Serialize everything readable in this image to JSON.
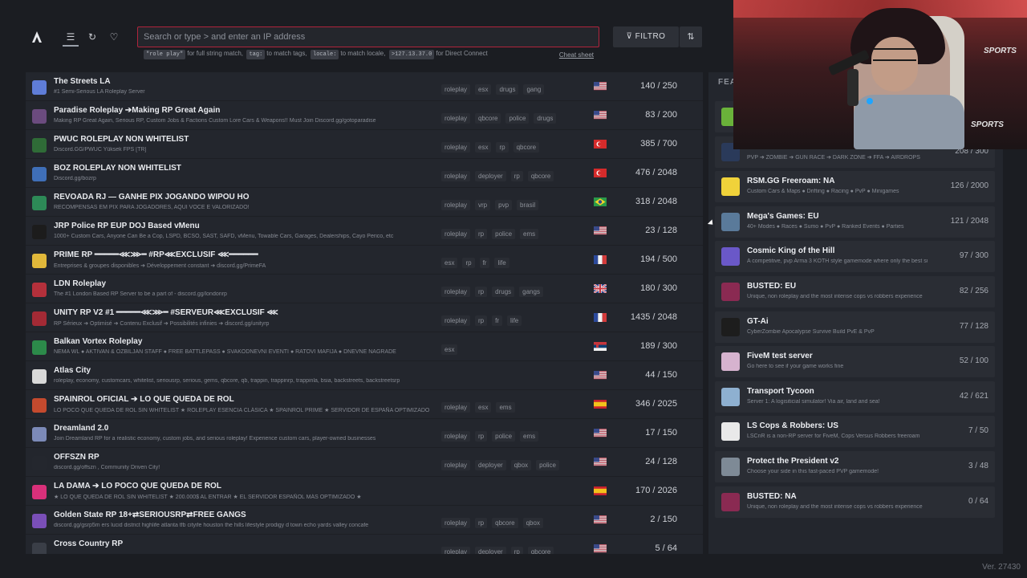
{
  "app": {
    "version": "Ver. 27430"
  },
  "toolbar": {
    "search_placeholder": "Search or type > and enter an IP address",
    "filter_label": "⊽ FILTRO",
    "sort_glyph": "⇅",
    "hints": [
      {
        "chip": "\"role play\"",
        "text": "for full string match,"
      },
      {
        "chip": "tag:",
        "text": "to match tags,"
      },
      {
        "chip": "locale:",
        "text": "to match locale,"
      },
      {
        "chip": ">127.13.37.0",
        "text": "for Direct Connect"
      }
    ],
    "cheat_sheet": "Cheat sheet"
  },
  "servers": [
    {
      "name": "The Streets LA",
      "desc": "#1 Semi-Serious LA Roleplay Server",
      "tags": [
        "roleplay",
        "esx",
        "drugs",
        "gang"
      ],
      "flag": "us",
      "players": "140 / 250",
      "icon_color": "#5f7dd8"
    },
    {
      "name": "Paradise Roleplay ➔Making RP Great Again",
      "desc": "Making RP Great Again, Serious RP, Custom Jobs & Factions Custom Lore Cars & Weapons!! Must Join Discord.gg/gotoparadise",
      "tags": [
        "roleplay",
        "qbcore",
        "police",
        "drugs"
      ],
      "flag": "us",
      "players": "83 / 200",
      "icon_color": "#6b4b7e"
    },
    {
      "name": "PWUC ROLEPLAY NON WHITELIST",
      "desc": "Discord.GG/PWUC Yüksek FPS [TR]",
      "tags": [
        "roleplay",
        "esx",
        "rp",
        "qbcore"
      ],
      "flag": "tr",
      "players": "385 / 700",
      "icon_color": "#2f6b37"
    },
    {
      "name": "BOZ ROLEPLAY NON WHITELIST",
      "desc": "Discord.gg/bozrp",
      "tags": [
        "roleplay",
        "deployer",
        "rp",
        "qbcore"
      ],
      "flag": "tr",
      "players": "476 / 2048",
      "icon_color": "#3f6fb8"
    },
    {
      "name": "REVOADA RJ — GANHE PIX JOGANDO WIPOU HO",
      "desc": "RECOMPENSAS EM PIX PARA JOGADORES, AQUI VOCÊ É VALORIZADO!",
      "tags": [
        "roleplay",
        "vrp",
        "pvp",
        "brasil"
      ],
      "flag": "br",
      "players": "318 / 2048",
      "icon_color": "#2d8a57"
    },
    {
      "name": "JRP Police RP EUP DOJ Based vMenu",
      "desc": "1000+ Custom Cars, Anyone Can Be a Cop, LSPD, BCSO, SAST, SAFD, vMenu, Towable Cars, Garages, Dealerships, Cayo Perico, etc",
      "tags": [
        "roleplay",
        "rp",
        "police",
        "ems"
      ],
      "flag": "us",
      "players": "23 / 128",
      "icon_color": "#1c1c1c"
    },
    {
      "name": "PRIME RP ━━━━━⋘⋙━ #RP⋘EXCLUSIF ⋘━━━━━━",
      "desc": "Entreprises & groupes disponibles ➔ Développement constant ➔ discord.gg/PrimeFA",
      "tags": [
        "esx",
        "rp",
        "fr",
        "life"
      ],
      "flag": "fr",
      "players": "194 / 500",
      "icon_color": "#e1b83a"
    },
    {
      "name": "LDN Roleplay",
      "desc": "The #1 London Based RP Server to be a part of - discord.gg/londonrp",
      "tags": [
        "roleplay",
        "rp",
        "drugs",
        "gangs"
      ],
      "flag": "uk",
      "players": "180 / 300",
      "icon_color": "#b4303b"
    },
    {
      "name": "UNITY RP V2 #1 ━━━━━⋘⋙━ #SERVEUR⋘EXCLUSIF ⋘",
      "desc": "RP Sérieux ➔ Optimisé ➔ Contenu Exclusif ➔ Possibilités infinies ➔ discord.gg/unityrp",
      "tags": [
        "roleplay",
        "rp",
        "fr",
        "life"
      ],
      "flag": "fr",
      "players": "1435 / 2048",
      "icon_color": "#a32a35"
    },
    {
      "name": "Balkan Vortex Roleplay",
      "desc": "NEMA WL ● AKTIVAN & OZBILJAN STAFF ● FREE BATTLEPASS ● SVAKODNEVNI EVENTI ● RATOVI MAFIJA ● DNEVNE NAGRADE",
      "tags": [
        "esx"
      ],
      "flag": "rs",
      "players": "189 / 300",
      "icon_color": "#2c8a4a"
    },
    {
      "name": "Atlas City",
      "desc": "roleplay, economy, customcars, whitelist, seriousrp, serious, gems, qbcore, qb, trappin, trappinrp, trappinla, bsia, backstreets, backstreetsrp",
      "tags": [],
      "flag": "us",
      "players": "44 / 150",
      "icon_color": "#d9d9d9"
    },
    {
      "name": "SPAINROL OFICIAL ➔ LO QUE QUEDA DE ROL",
      "desc": "LO POCO QUE QUEDA DE ROL SIN WHITELIST ★ ROLEPLAY ESENCIA CLÁSICA ★ SPAINROL PRIME ★ SERVIDOR DE ESPAÑA OPTIMIZADO",
      "tags": [
        "roleplay",
        "esx",
        "ems"
      ],
      "flag": "es",
      "players": "346 / 2025",
      "icon_color": "#c44a2e"
    },
    {
      "name": "Dreamland 2.0",
      "desc": "Join Dreamland RP for a realistic economy, custom jobs, and serious roleplay! Experience custom cars, player-owned businesses",
      "tags": [
        "roleplay",
        "rp",
        "police",
        "ems"
      ],
      "flag": "us",
      "players": "17 / 150",
      "icon_color": "#7c8ab8"
    },
    {
      "name": "OFFSZN RP",
      "desc": "discord.gg/offszn , Community Driven City!",
      "tags": [
        "roleplay",
        "deployer",
        "qbox",
        "police"
      ],
      "flag": "us",
      "players": "24 / 128",
      "icon_color": "#24272e"
    },
    {
      "name": "LA DAMA ➔ LO POCO QUE QUEDA DE ROL",
      "desc": "★ LO QUE QUEDA DE ROL SIN WHITELIST ★ 200.000$ AL ENTRAR ★ EL SERVIDOR ESPAÑOL MÁS OPTIMIZADO ★",
      "tags": [],
      "flag": "es",
      "players": "170 / 2026",
      "icon_color": "#d9307a"
    },
    {
      "name": "Golden State RP 18+⇄SERIOUSRP⇄FREE GANGS",
      "desc": "discord.gg/gsrp5m ers lucid district highlife atlanta tfb cityife houston the hills lifestyle prodigy d town echo yards valley concafe",
      "tags": [
        "roleplay",
        "rp",
        "qbcore",
        "qbox"
      ],
      "flag": "us",
      "players": "2 / 150",
      "icon_color": "#7a4fb8"
    },
    {
      "name": "Cross Country RP",
      "desc": "",
      "tags": [
        "roleplay",
        "deployer",
        "rp",
        "qbcore"
      ],
      "flag": "us",
      "players": "5 / 64",
      "icon_color": "#3a3e47"
    }
  ],
  "featured": {
    "title": "FEA",
    "items": [
      {
        "name": "",
        "desc": "",
        "players": "",
        "icon_color": "#6ab23a"
      },
      {
        "name": "",
        "desc": "PVP ➔ ZOMBIE ➔ GUN RACE ➔ DARK ZONE ➔ FFA ➔ AIRDROPS",
        "players": "208 / 300",
        "icon_color": "#2a3a5a"
      },
      {
        "name": "RSM.GG Freeroam: NA",
        "desc": "Custom Cars & Maps ● Drifting ● Racing ● PvP ● Minigames",
        "players": "126 / 2000",
        "icon_color": "#f0d23a"
      },
      {
        "name": "Mega's Games: EU",
        "desc": "40+ Modes ● Races ● Sumo ● PvP ● Ranked Events ● Parties",
        "players": "121 / 2048",
        "icon_color": "#5a7a9a"
      },
      {
        "name": "Cosmic King of the Hill",
        "desc": "A competitive, pvp Arma 3 KOTH style gamemode where only the best survive",
        "players": "97 / 300",
        "icon_color": "#6a58c8"
      },
      {
        "name": "BUSTED: EU",
        "desc": "Unique, non roleplay and the most intense cops vs robbers experience",
        "players": "82 / 256",
        "icon_color": "#8a2a52"
      },
      {
        "name": "GT-Ai",
        "desc": "CyberZombie Apocalypse Survive Build PvE & PvP",
        "players": "77 / 128",
        "icon_color": "#1d1d1d"
      },
      {
        "name": "FiveM test server",
        "desc": "Go here to see if your game works fine",
        "players": "52 / 100",
        "icon_color": "#d6b3cf"
      },
      {
        "name": "Transport Tycoon",
        "desc": "Server 1: A logisiticial simulator! Via air, land and sea!",
        "players": "42 / 621",
        "icon_color": "#8eb0d0"
      },
      {
        "name": "LS Cops & Robbers: US",
        "desc": "LSCnR is a non-RP server for FiveM, Cops Versus Robbers freeroam",
        "players": "7 / 50",
        "icon_color": "#e9e9e9"
      },
      {
        "name": "Protect the President v2",
        "desc": "Choose your side in this fast-paced PVP gamemode!",
        "players": "3 / 48",
        "icon_color": "#7e8a96"
      },
      {
        "name": "BUSTED: NA",
        "desc": "Unique, non roleplay and the most intense cops vs robbers experience",
        "players": "0 / 64",
        "icon_color": "#8a2a52"
      }
    ]
  },
  "webcam": {
    "watermark_1": "SPORTS",
    "watermark_2": "SPORTS"
  }
}
